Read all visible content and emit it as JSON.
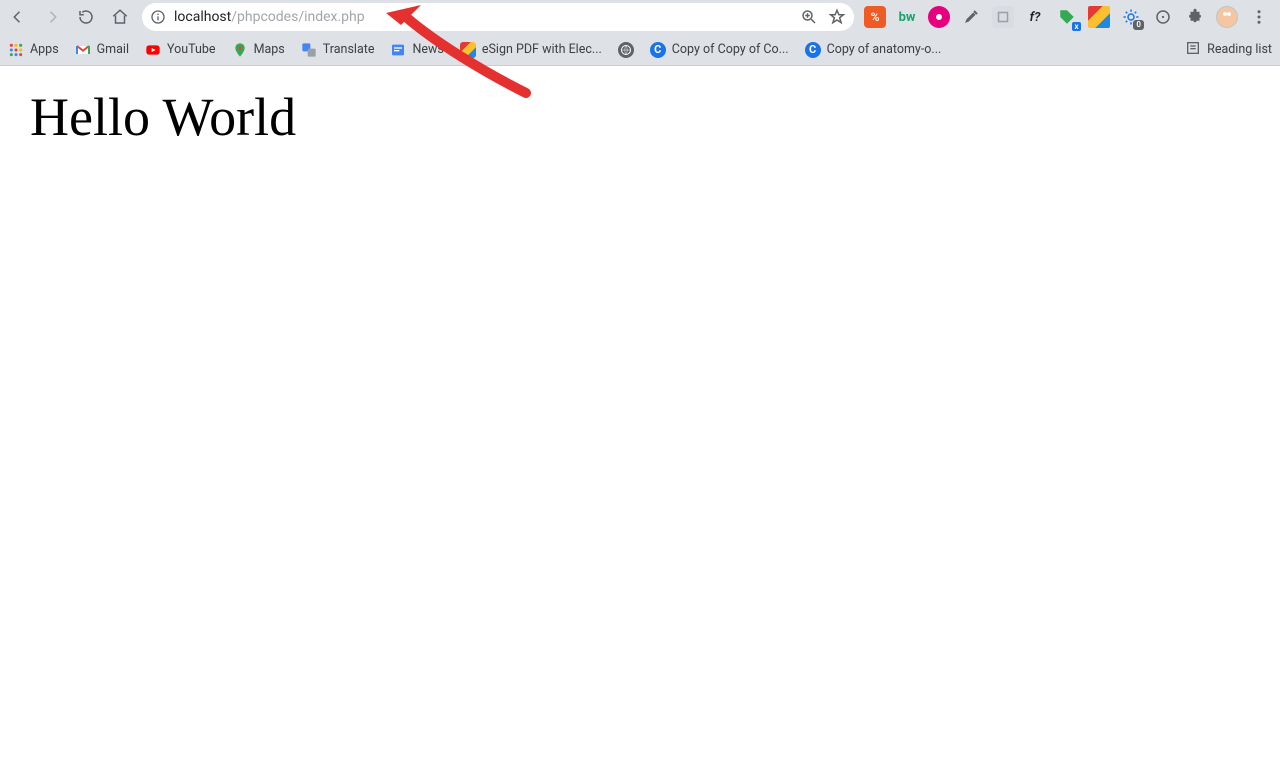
{
  "toolbar": {
    "url_dark": "localhost",
    "url_rest": "/phpcodes/index.php"
  },
  "bookmarks": {
    "apps": "Apps",
    "gmail": "Gmail",
    "youtube": "YouTube",
    "maps": "Maps",
    "translate": "Translate",
    "news": "News",
    "esign": "eSign PDF with Elec...",
    "copy1": "Copy of Copy of Co...",
    "copy2": "Copy of anatomy-o...",
    "reading_list": "Reading list"
  },
  "extensions": {
    "item1_label": "%",
    "item2_label": "bw",
    "item5_label": "f?"
  },
  "page": {
    "heading": "Hello World"
  }
}
